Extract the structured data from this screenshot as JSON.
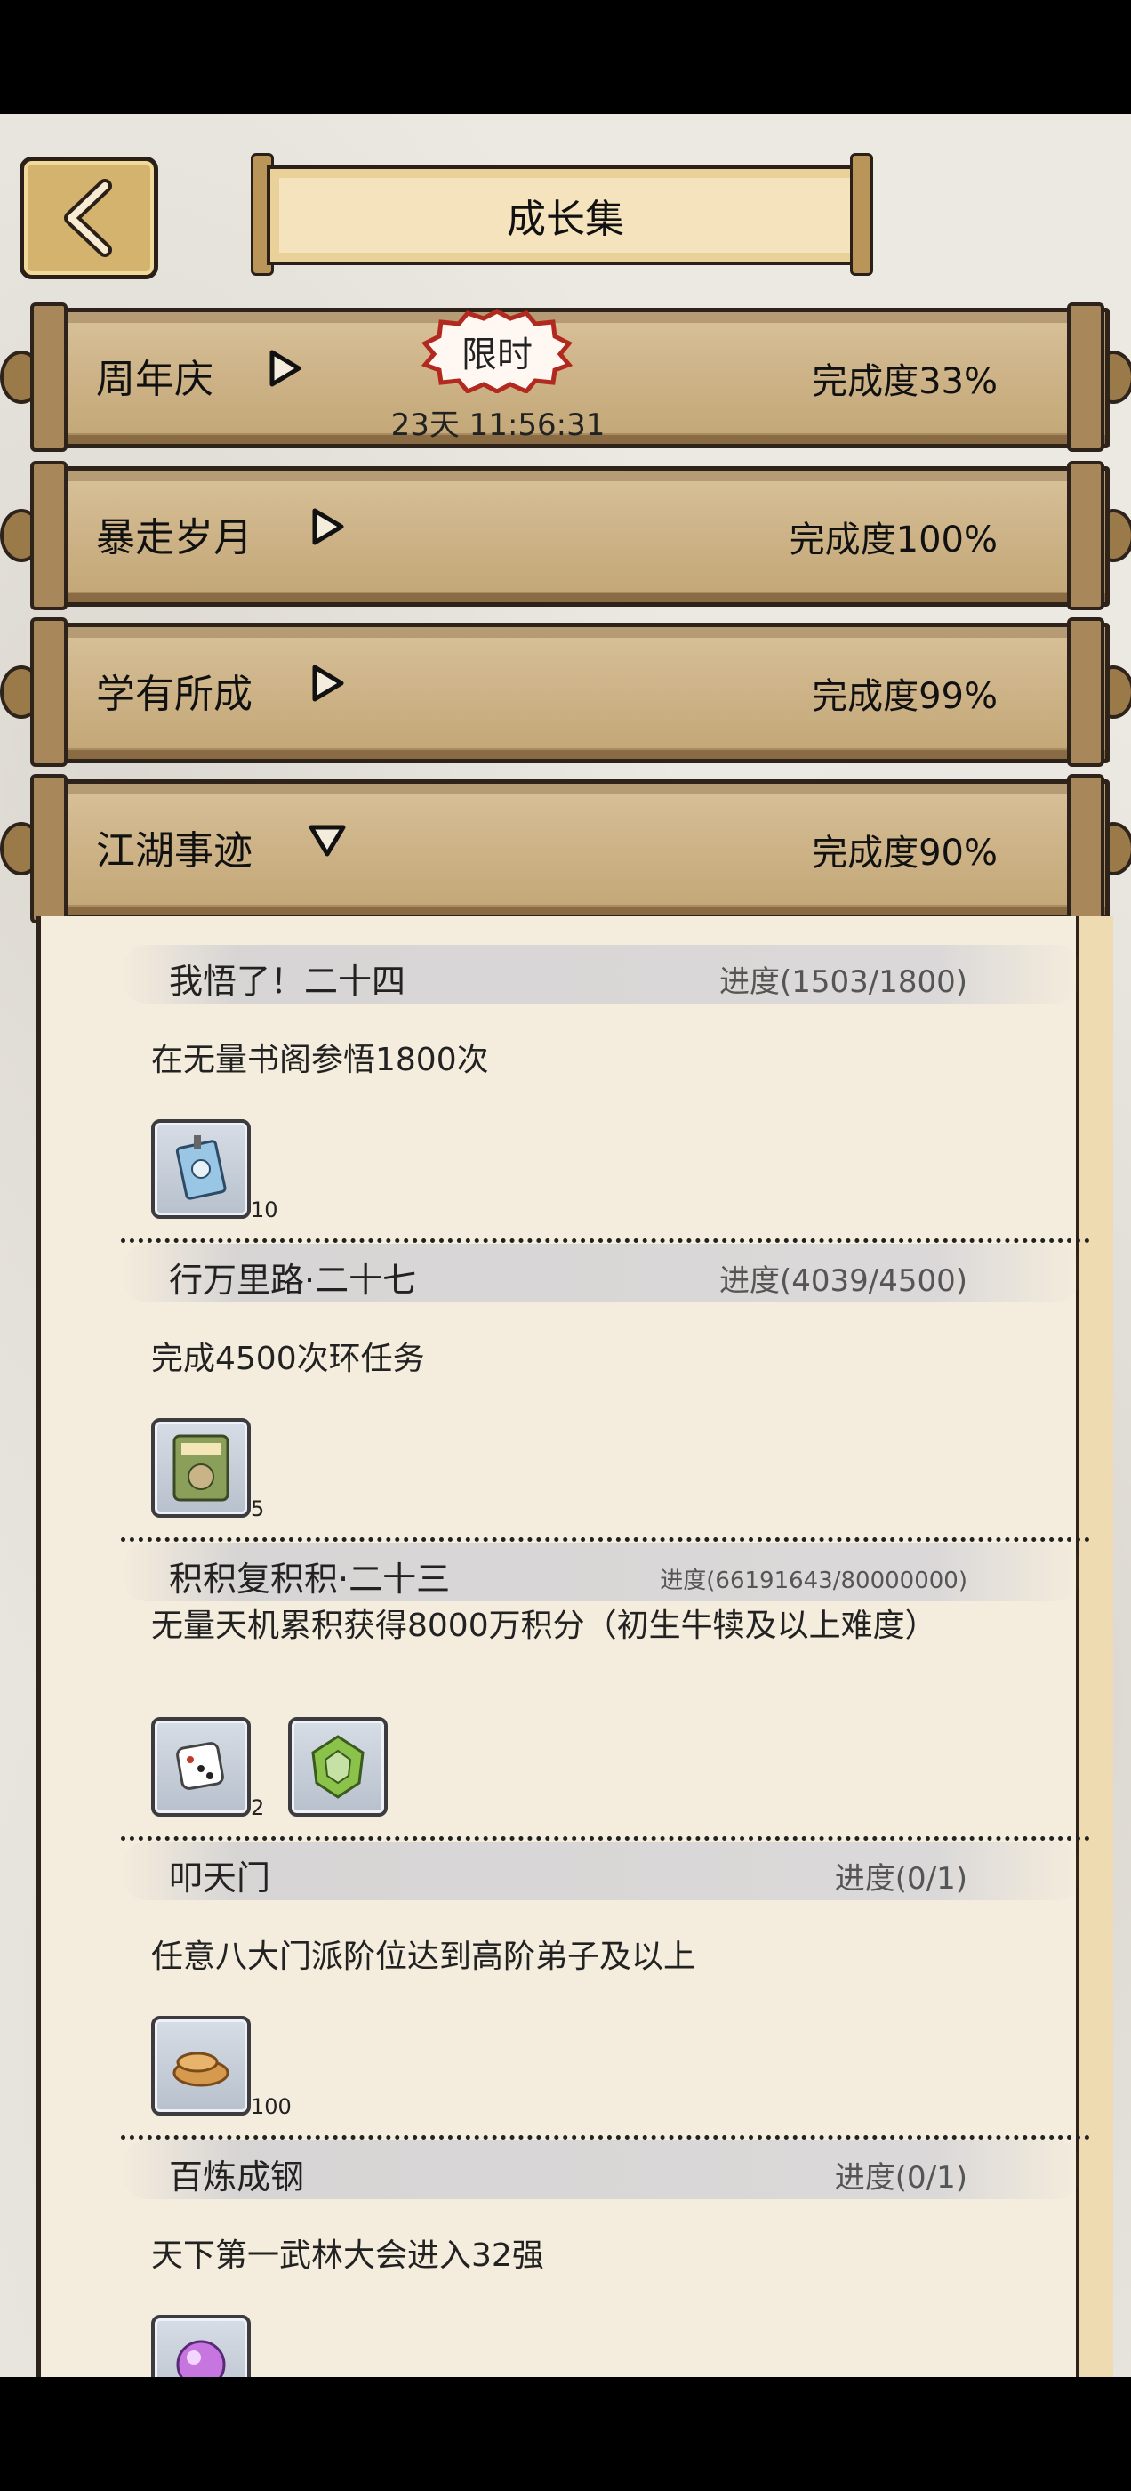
{
  "header": {
    "title": "成长集",
    "back_label": "返回"
  },
  "categories": [
    {
      "label": "周年庆",
      "completion": "完成度33%",
      "expanded": false,
      "badge": "限时",
      "timer": "23天 11:56:31"
    },
    {
      "label": "暴走岁月",
      "completion": "完成度100%",
      "expanded": false
    },
    {
      "label": "学有所成",
      "completion": "完成度99%",
      "expanded": false
    },
    {
      "label": "江湖事迹",
      "completion": "完成度90%",
      "expanded": true
    }
  ],
  "tasks": [
    {
      "name": "我悟了！二十四",
      "progress": "进度(1503/1800)",
      "desc": "在无量书阁参悟1800次",
      "rewards": [
        {
          "icon": "skill-book-icon",
          "qty": "10"
        }
      ]
    },
    {
      "name": "行万里路·二十七",
      "progress": "进度(4039/4500)",
      "desc": "完成4500次环任务",
      "rewards": [
        {
          "icon": "elixir-pack-icon",
          "qty": "5"
        }
      ]
    },
    {
      "name": "积积复积积·二十三",
      "progress": "进度(66191643/80000000)",
      "desc": "无量天机累积获得8000万积分（初生牛犊及以上难度）",
      "rewards": [
        {
          "icon": "dice-icon",
          "qty": "2"
        },
        {
          "icon": "jade-token-icon",
          "qty": ""
        }
      ]
    },
    {
      "name": "叩天门",
      "progress": "进度(0/1)",
      "desc": "任意八大门派阶位达到高阶弟子及以上",
      "rewards": [
        {
          "icon": "pastry-icon",
          "qty": "100"
        }
      ]
    },
    {
      "name": "百炼成钢",
      "progress": "进度(0/1)",
      "desc": "天下第一武林大会进入32强",
      "rewards": [
        {
          "icon": "spirit-orb-icon",
          "qty": ""
        }
      ]
    }
  ]
}
